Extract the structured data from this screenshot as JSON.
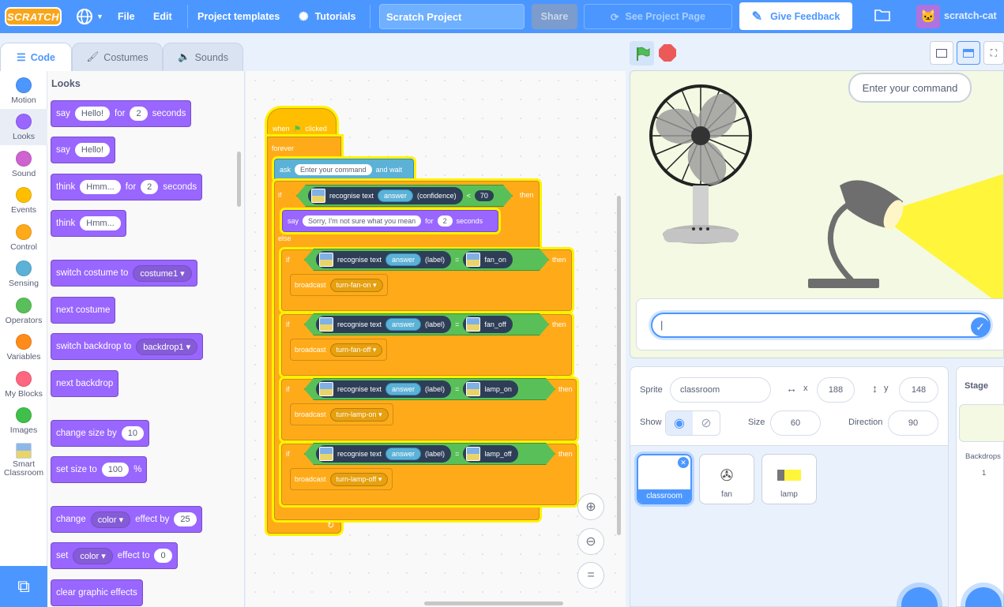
{
  "menu": {
    "logo": "SCRATCH",
    "items": [
      "File",
      "Edit",
      "Project templates",
      "Tutorials"
    ],
    "project_title": "Scratch Project",
    "share": "Share",
    "see_project_page": "See Project Page",
    "feedback": "Give Feedback",
    "username": "scratch-cat"
  },
  "tabs": [
    "Code",
    "Costumes",
    "Sounds"
  ],
  "categories": [
    {
      "label": "Motion",
      "color": "#4c97ff"
    },
    {
      "label": "Looks",
      "color": "#9966ff"
    },
    {
      "label": "Sound",
      "color": "#cf63cf"
    },
    {
      "label": "Events",
      "color": "#ffbf00"
    },
    {
      "label": "Control",
      "color": "#ffab19"
    },
    {
      "label": "Sensing",
      "color": "#5cb1d6"
    },
    {
      "label": "Operators",
      "color": "#59c059"
    },
    {
      "label": "Variables",
      "color": "#ff8c1a"
    },
    {
      "label": "My Blocks",
      "color": "#ff6680"
    },
    {
      "label": "Images",
      "color": "#40bf4a"
    },
    {
      "label": "Smart Classroom",
      "color": "icon"
    }
  ],
  "palette": {
    "title": "Looks",
    "blocks": [
      {
        "parts": [
          "say",
          "[Hello!]",
          "for",
          "[2]",
          "seconds"
        ]
      },
      {
        "parts": [
          "say",
          "[Hello!]"
        ]
      },
      {
        "parts": [
          "think",
          "[Hmm...]",
          "for",
          "[2]",
          "seconds"
        ]
      },
      {
        "parts": [
          "think",
          "[Hmm...]"
        ]
      },
      {
        "parts": [
          "switch costume to",
          "{costume1}"
        ]
      },
      {
        "parts": [
          "next costume"
        ]
      },
      {
        "parts": [
          "switch backdrop to",
          "{backdrop1}"
        ]
      },
      {
        "parts": [
          "next backdrop"
        ]
      },
      {
        "parts": [
          "change size by",
          "[10]"
        ]
      },
      {
        "parts": [
          "set size to",
          "[100]",
          "%"
        ]
      },
      {
        "parts": [
          "change",
          "{color}",
          "effect by",
          "[25]"
        ]
      },
      {
        "parts": [
          "set",
          "{color}",
          "effect to",
          "[0]"
        ]
      },
      {
        "parts": [
          "clear graphic effects"
        ]
      }
    ]
  },
  "script": {
    "when": "when",
    "clicked": "clicked",
    "forever": "forever",
    "ask": "ask",
    "ask_text": "Enter your command",
    "and_wait": "and wait",
    "if": "if",
    "then": "then",
    "else": "else",
    "recognise": "recognise text",
    "answer": "answer",
    "confidence": "(confidence)",
    "label": "(label)",
    "lt": "<",
    "eq": "=",
    "threshold": "70",
    "say": "say",
    "say_text": "Sorry, I'm not sure what you mean",
    "for": "for",
    "secs_val": "2",
    "seconds": "seconds",
    "broadcast": "broadcast",
    "rules": [
      {
        "label": "fan_on",
        "message": "turn-fan-on"
      },
      {
        "label": "fan_off",
        "message": "turn-fan-off"
      },
      {
        "label": "lamp_on",
        "message": "turn-lamp-on"
      },
      {
        "label": "lamp_off",
        "message": "turn-lamp-off"
      }
    ]
  },
  "stage": {
    "speech": "Enter your command",
    "answer_value": "|"
  },
  "sprite_info": {
    "sprite_label": "Sprite",
    "sprite_name": "classroom",
    "x_label": "x",
    "x": "188",
    "y_label": "y",
    "y": "148",
    "show_label": "Show",
    "size_label": "Size",
    "size": "60",
    "direction_label": "Direction",
    "direction": "90"
  },
  "sprites": [
    {
      "name": "classroom",
      "selected": true
    },
    {
      "name": "fan",
      "selected": false
    },
    {
      "name": "lamp",
      "selected": false
    }
  ],
  "stage_pane": {
    "title": "Stage",
    "backdrops_label": "Backdrops",
    "backdrops_count": "1"
  }
}
